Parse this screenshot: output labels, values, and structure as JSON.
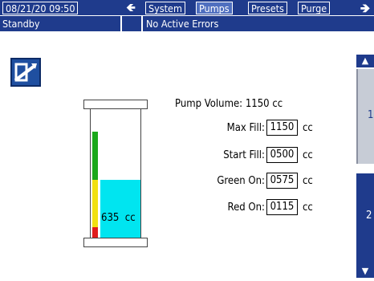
{
  "header": {
    "datetime": "08/21/20 09:50",
    "back_icon": "left-arrow-icon",
    "tabs": [
      {
        "label": "System",
        "active": false
      },
      {
        "label": "Pumps",
        "active": true
      },
      {
        "label": "Presets",
        "active": false
      },
      {
        "label": "Purge",
        "active": false
      }
    ],
    "next_icon": "right-arrow-icon"
  },
  "status_bar": {
    "mode": "Standby",
    "errors": "No Active Errors"
  },
  "edit_icon": "edit-icon",
  "tank": {
    "current_volume": "635",
    "current_volume_unit": "cc",
    "fill_fraction": 0.55,
    "colors": {
      "fluid": "#00e5f0",
      "green": "#1aa81a",
      "yellow": "#f2e010",
      "red": "#e01b1b"
    }
  },
  "settings": {
    "pump_volume_label": "Pump Volume:",
    "pump_volume_value": "1150 cc",
    "unit": "cc",
    "max_fill_label": "Max Fill:",
    "max_fill_value": "1150",
    "start_fill_label": "Start Fill:",
    "start_fill_value": "0500",
    "green_on_label": "Green On:",
    "green_on_value": "0575",
    "red_on_label": "Red On:",
    "red_on_value": "0115"
  },
  "sidebar": {
    "up_icon": "up-arrow-icon",
    "down_icon": "down-arrow-icon",
    "pages": [
      "1",
      "2"
    ]
  },
  "accent_color": "#1f3b8c"
}
